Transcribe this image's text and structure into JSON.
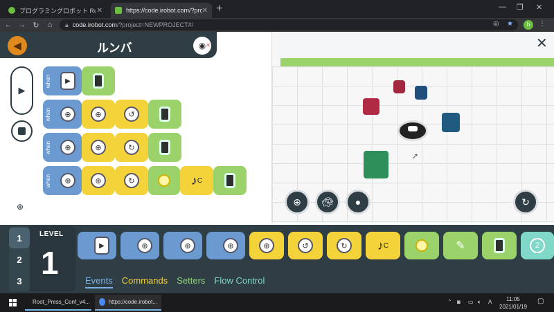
{
  "browser": {
    "tabs": [
      {
        "title": "プログラミングロボット Root | iRobot",
        "active": false
      },
      {
        "title": "https://code.irobot.com/?project=",
        "active": true
      }
    ],
    "new_tab": "+",
    "url_domain": "code.irobot.com",
    "url_path": "/?project=NEWPROJECT#/",
    "profile_initial": "h",
    "window_controls": {
      "minimize": "—",
      "maximize": "❐",
      "close": "✕"
    }
  },
  "app": {
    "project_title": "ルンバ",
    "sim_badge": "✕",
    "close_scene": "✕",
    "script_rows": [
      {
        "when": "when",
        "blocks": [
          "play",
          "wheel"
        ]
      },
      {
        "when": "when",
        "blocks": [
          "bumper",
          "move",
          "rotate-left",
          "wheel"
        ]
      },
      {
        "when": "when",
        "blocks": [
          "bumper",
          "move",
          "rotate-right",
          "wheel"
        ]
      },
      {
        "when": "when",
        "blocks": [
          "bumper",
          "move",
          "rotate-right",
          "light",
          "note",
          "wheel"
        ]
      }
    ],
    "note_label": "C",
    "level": {
      "label": "LEVEL",
      "value": "1",
      "tabs": [
        "1",
        "2",
        "3"
      ],
      "active_tab": "1"
    },
    "categories": [
      "Events",
      "Commands",
      "Setters",
      "Flow Control"
    ],
    "active_category": "Events",
    "palette_note": "C",
    "palette_repeat": "2"
  },
  "taskbar": {
    "items": [
      {
        "label": "Root_Press_Conf_v4...",
        "color": "#d9342b"
      },
      {
        "label": "https://code.irobot...",
        "color": "#4a8af4"
      }
    ],
    "time": "11:05",
    "date": "2021/01/19"
  },
  "colors": {
    "header": "#2f3d45",
    "event_block": "#6b9ad0",
    "command_block": "#f3d23a",
    "setter_block": "#9bd36a",
    "back_button": "#e08a1e"
  }
}
